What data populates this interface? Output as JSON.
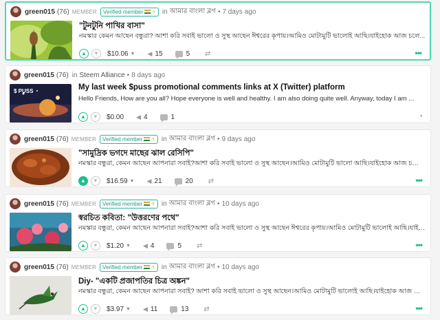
{
  "feed": {
    "posts": [
      {
        "author": "green015",
        "reputation": "(76)",
        "member_label": "MEMBER",
        "verified_label": "Verified member",
        "in_label": "in",
        "community": "আমার বাংলা ব্লগ",
        "bullet": "•",
        "age": "7 days ago",
        "title": "\"টুনটুনি পাখির বাসা\"",
        "excerpt": "নমস্কার কেমন আছেন বন্ধুরা? আশা করি সবাই ভালো ও সুস্থ আছেন ঈশ্বরের কৃপায়।আমিও মোটামুটি ভালোই আছি।যাইহোক আজ চলে...",
        "payout": "$10.06",
        "votes": "15",
        "comments": "5",
        "upvoted": false
      },
      {
        "author": "green015",
        "reputation": "(76)",
        "member_label": "",
        "verified_label": "",
        "in_label": "in",
        "community": "Steem Alliance",
        "bullet": "•",
        "age": "8 days ago",
        "title": "My last week $puss promotional comments links at X (Twitter) platform",
        "excerpt": "Hello Friends, How are you all? Hope everyone is well and healthy. I am also doing quite well. Anyway, today I am ...",
        "payout": "$0.00",
        "votes": "4",
        "comments": "1",
        "upvoted": false,
        "thumb_label": "$ PUSS"
      },
      {
        "author": "green015",
        "reputation": "(76)",
        "member_label": "MEMBER",
        "verified_label": "Verified member",
        "in_label": "in",
        "community": "আমার বাংলা ব্লগ",
        "bullet": "•",
        "age": "9 days ago",
        "title": "\"সামুদ্রিক ভগদে মাছের ঝাল রেসিপি\"",
        "excerpt": "নমস্কার বন্ধুরা, কেমন আছেন আপনারা সবাই?আশা করি সবাই ভালো ও সুস্থ আছেন।আমিও মোটামুটি ভালো আছি।যাইহোক আজ চলে আসলা...",
        "payout": "$16.59",
        "votes": "21",
        "comments": "20",
        "upvoted": true
      },
      {
        "author": "green015",
        "reputation": "(76)",
        "member_label": "MEMBER",
        "verified_label": "Verified member",
        "in_label": "in",
        "community": "আমার বাংলা ব্লগ",
        "bullet": "•",
        "age": "10 days ago",
        "title": "স্বরচিত কবিতা: \"উত্তরণের পথে\"",
        "excerpt": "নমস্কার বন্ধুরা, কেমন আছেন আপনারা সবাই?আশা করি সবাই ভালো ও সুস্থ আছেন ঈশ্বরের কৃপায়।আমিও মোটামুটি ভালোই আছি।যাইহোক আজ চলে...",
        "payout": "$1.20",
        "votes": "4",
        "comments": "5",
        "upvoted": false
      },
      {
        "author": "green015",
        "reputation": "(76)",
        "member_label": "MEMBER",
        "verified_label": "Verified member",
        "in_label": "in",
        "community": "আমার বাংলা ব্লগ",
        "bullet": "•",
        "age": "10 days ago",
        "title": "Diy- \"একটি প্রজাপতির চিত্র অঙ্কন\"",
        "excerpt": "নমস্কার বন্ধুরা, কেমন আছেন আপনারা সবাই? আশা করি সবাই ভালো ও সুস্থ আছেন।আমিও মোটামুটি ভালোই আছি।যাইহোক আজ আমি এক...",
        "payout": "$3.97",
        "votes": "11",
        "comments": "13",
        "upvoted": false
      }
    ]
  },
  "icons": {
    "upvote": "chevron-up-icon",
    "downvote": "chevron-down-icon",
    "voters": "chevron-left-icon",
    "comments": "comment-icon",
    "reblog": "reblog-icon",
    "more": "more-dots-icon"
  },
  "colors": {
    "accent": "#1fbf8f",
    "highlight_border": "#4fd6b2"
  }
}
